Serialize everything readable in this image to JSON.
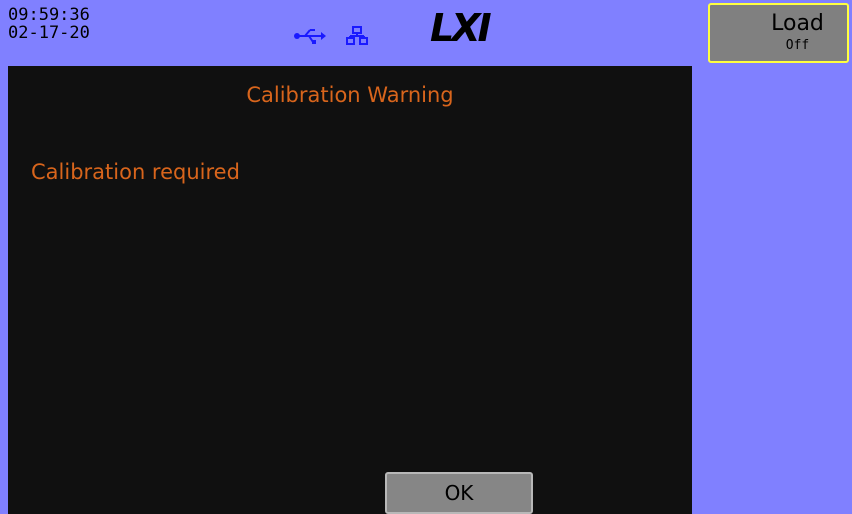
{
  "status_bar": {
    "time": "09:59:36",
    "date": "02-17-20",
    "usb_icon": "usb-icon",
    "network_icon": "lan-icon",
    "logo_text": "LXI"
  },
  "softkeys": {
    "load": {
      "label": "Load",
      "value": "Off"
    }
  },
  "dialog": {
    "title": "Calibration Warning",
    "message": "Calibration required",
    "ok_label": "OK"
  },
  "colors": {
    "background": "#8080ff",
    "panel": "#101010",
    "text_accent": "#d8651c",
    "icon": "#1a1aff",
    "softkey_highlight": "#ffff40"
  }
}
